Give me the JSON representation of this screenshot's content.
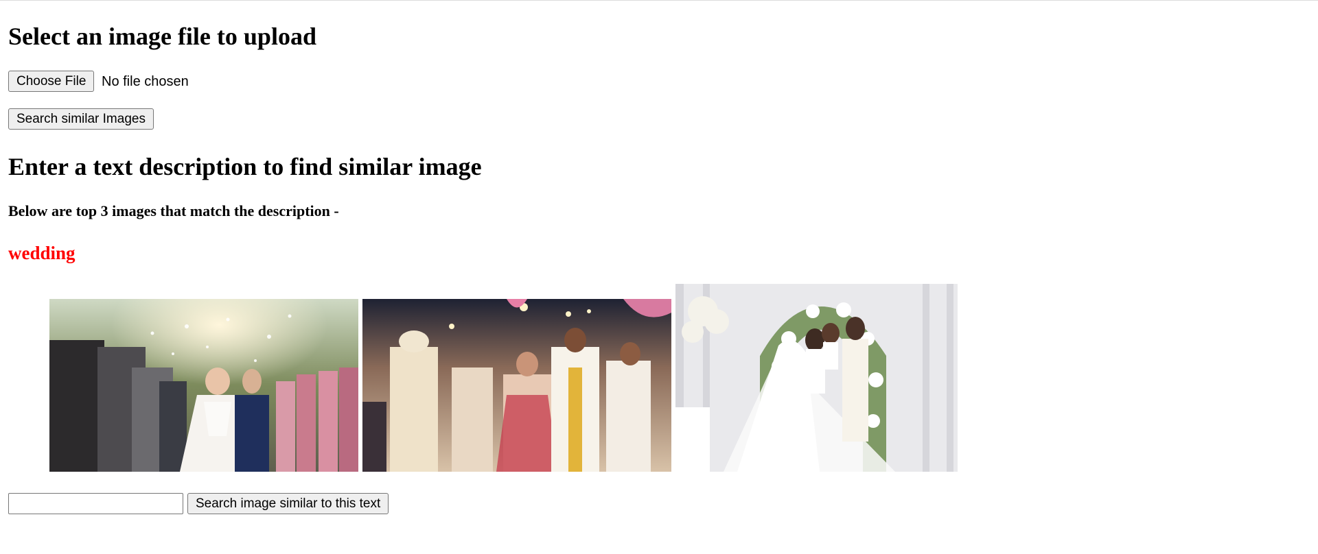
{
  "upload": {
    "heading": "Select an image file to upload",
    "choose_file_label": "Choose File",
    "file_status": "No file chosen",
    "search_button_label": "Search similar Images"
  },
  "text_search": {
    "heading": "Enter a text description to find similar image",
    "results_caption": "Below are top 3 images that match the description -",
    "query": "wedding",
    "input_value": "",
    "search_button_label": "Search image similar to this text"
  },
  "results": [
    {
      "icon": "wedding-photo-outdoor-petals"
    },
    {
      "icon": "wedding-photo-indian-ceremony"
    },
    {
      "icon": "wedding-photo-floral-arch"
    }
  ]
}
